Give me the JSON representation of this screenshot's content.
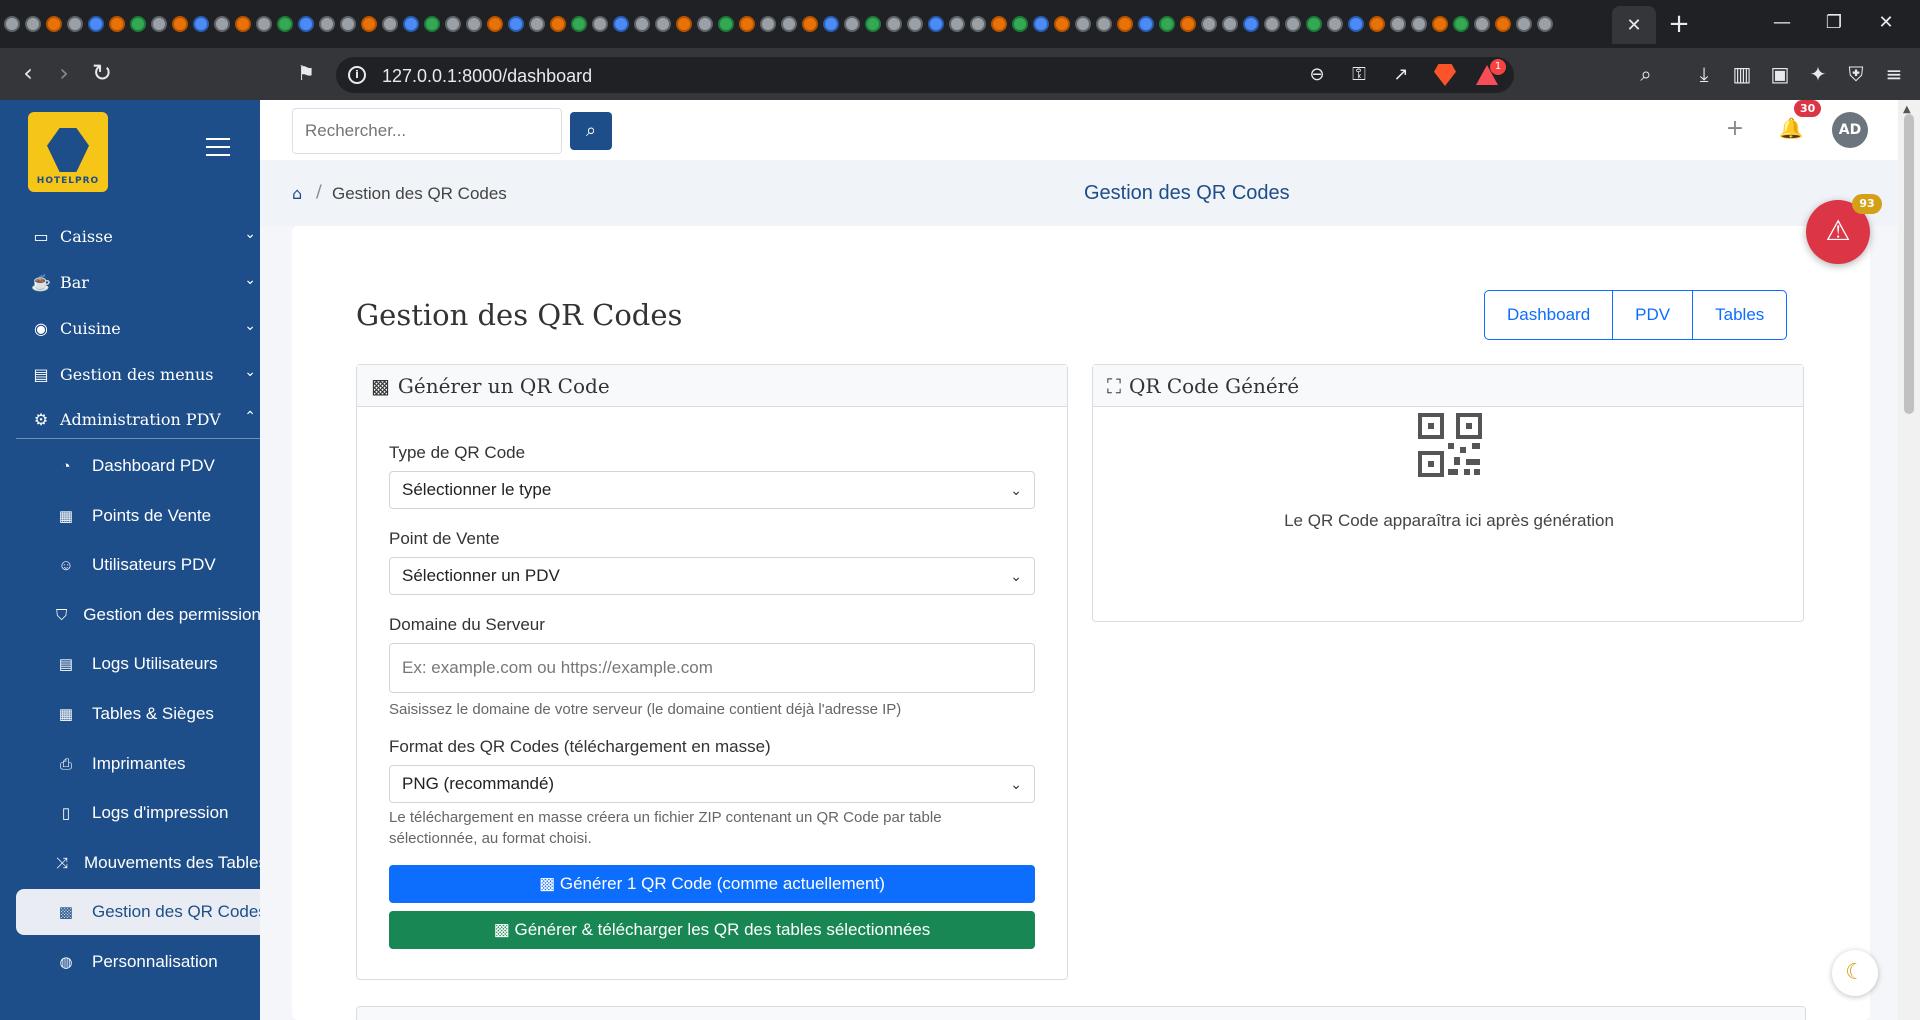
{
  "browser": {
    "url": "127.0.0.1:8000/dashboard",
    "extension_badge": "1"
  },
  "sidebar": {
    "brand": "HOTELPRO",
    "groups": [
      {
        "label": "Caisse",
        "icon": "cash-register-icon"
      },
      {
        "label": "Bar",
        "icon": "coffee-icon"
      },
      {
        "label": "Cuisine",
        "icon": "pot-icon"
      },
      {
        "label": "Gestion des menus",
        "icon": "menu-book-icon"
      },
      {
        "label": "Administration PDV",
        "icon": "gear-icon"
      }
    ],
    "items": [
      {
        "label": "Dashboard PDV",
        "icon": "gauge-icon"
      },
      {
        "label": "Points de Vente",
        "icon": "building-icon"
      },
      {
        "label": "Utilisateurs PDV",
        "icon": "users-icon"
      },
      {
        "label": "Gestion des permissions",
        "icon": "shield-icon"
      },
      {
        "label": "Logs Utilisateurs",
        "icon": "log-icon"
      },
      {
        "label": "Tables & Sièges",
        "icon": "table-icon"
      },
      {
        "label": "Imprimantes",
        "icon": "printer-icon"
      },
      {
        "label": "Logs d'impression",
        "icon": "doc-icon"
      },
      {
        "label": "Mouvements des Tables",
        "icon": "shuffle-icon"
      },
      {
        "label": "Gestion des QR Codes",
        "icon": "qr-icon"
      },
      {
        "label": "Personnalisation",
        "icon": "palette-icon"
      }
    ]
  },
  "topbar": {
    "search_placeholder": "Rechercher...",
    "notifications_count": "30",
    "avatar_initials": "AD"
  },
  "breadcrumb": {
    "current": "Gestion des QR Codes",
    "page_title": "Gestion des QR Codes"
  },
  "alert_count": "93",
  "main": {
    "heading": "Gestion des QR Codes",
    "nav_buttons": [
      "Dashboard",
      "PDV",
      "Tables"
    ],
    "generate_panel": {
      "title": "Générer un QR Code",
      "type_label": "Type de QR Code",
      "type_value": "Sélectionner le type",
      "pdv_label": "Point de Vente",
      "pdv_value": "Sélectionner un PDV",
      "domain_label": "Domaine du Serveur",
      "domain_placeholder": "Ex: example.com ou https://example.com",
      "domain_help": "Saisissez le domaine de votre serveur (le domaine contient déjà l'adresse IP)",
      "format_label": "Format des QR Codes (téléchargement en masse)",
      "format_value": "PNG (recommandé)",
      "format_help_1": "Le téléchargement en masse créera un fichier ZIP contenant un QR Code par table",
      "format_help_2": "sélectionnée, au format choisi.",
      "btn_single": "Générer 1 QR Code (comme actuellement)",
      "btn_bulk": "Générer & télécharger les QR des tables sélectionnées"
    },
    "result_panel": {
      "title": "QR Code Généré",
      "placeholder": "Le QR Code apparaîtra ici après génération"
    }
  },
  "colors": {
    "sidebar": "#1d4e89",
    "primary": "#0d6efd",
    "success": "#198754",
    "danger": "#dc3545"
  }
}
